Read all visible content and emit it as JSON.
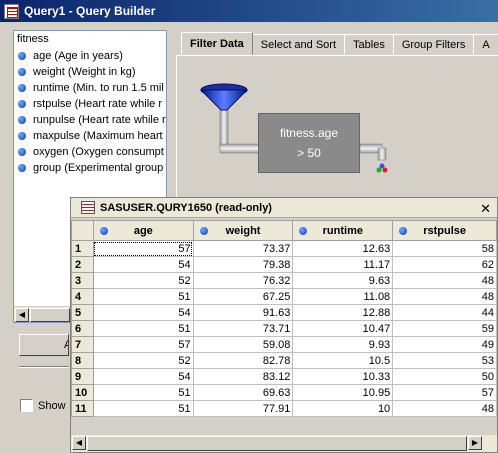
{
  "window": {
    "title": "Query1 - Query Builder"
  },
  "left_panel": {
    "root": "fitness",
    "fields": [
      "age (Age in years)",
      "weight (Weight in kg)",
      "runtime (Min. to run 1.5 mil",
      "rstpulse (Heart rate while r",
      "runpulse (Heart rate while r",
      "maxpulse (Maximum heart r",
      "oxygen (Oxygen consumpt",
      "group (Experimental group"
    ]
  },
  "tabs": [
    "Filter Data",
    "Select and Sort",
    "Tables",
    "Group Filters",
    "A"
  ],
  "filter": {
    "line1": "fitness.age",
    "line2": "> 50"
  },
  "bottom_left": {
    "button_label": "A",
    "show_label": "Show"
  },
  "data_window": {
    "title": "SASUSER.QURY1650 (read-only)",
    "close": "✕",
    "columns": [
      "age",
      "weight",
      "runtime",
      "rstpulse"
    ],
    "rows": [
      [
        "1",
        "57",
        "73.37",
        "12.63",
        "58"
      ],
      [
        "2",
        "54",
        "79.38",
        "11.17",
        "62"
      ],
      [
        "3",
        "52",
        "76.32",
        "9.63",
        "48"
      ],
      [
        "4",
        "51",
        "67.25",
        "11.08",
        "48"
      ],
      [
        "5",
        "54",
        "91.63",
        "12.88",
        "44"
      ],
      [
        "6",
        "51",
        "73.71",
        "10.47",
        "59"
      ],
      [
        "7",
        "57",
        "59.08",
        "9.93",
        "49"
      ],
      [
        "8",
        "52",
        "82.78",
        "10.5",
        "53"
      ],
      [
        "9",
        "54",
        "83.12",
        "10.33",
        "50"
      ],
      [
        "10",
        "51",
        "69.63",
        "10.95",
        "57"
      ],
      [
        "11",
        "51",
        "77.91",
        "10",
        "48"
      ]
    ]
  }
}
